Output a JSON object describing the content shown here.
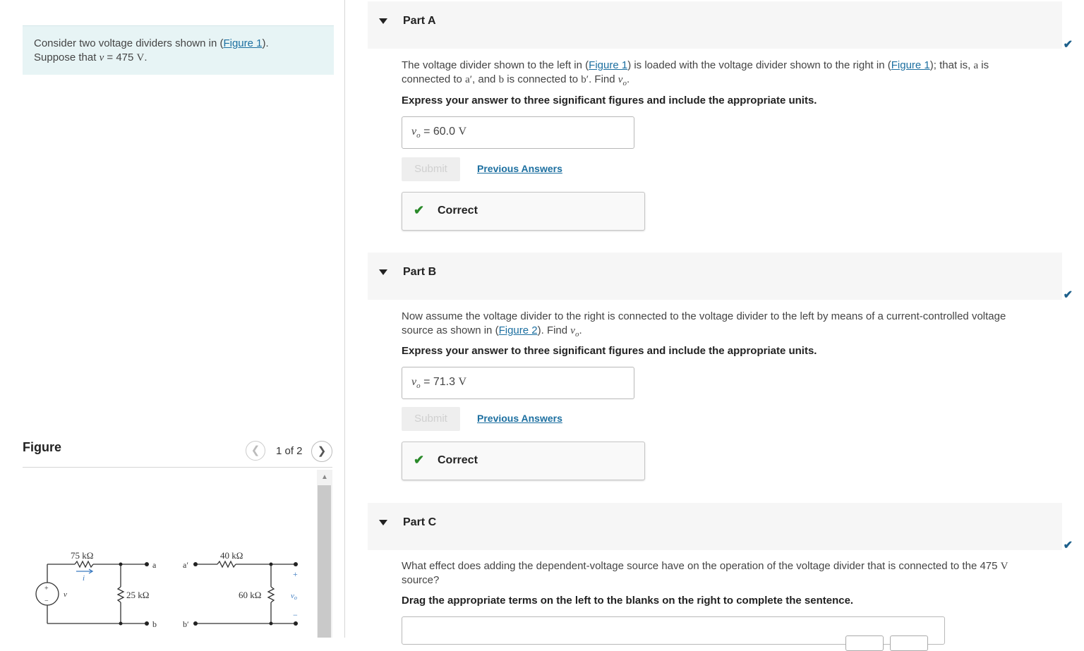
{
  "problem": {
    "line1_prefix": "Consider two voltage dividers shown in (",
    "figure_link": "Figure 1",
    "line1_suffix": ").",
    "line2_prefix": "Suppose that ",
    "v_symbol": "v",
    "line2_mid": " = 475 ",
    "unit": "V",
    "line2_suffix": "."
  },
  "figure": {
    "title": "Figure",
    "counter": "1 of 2",
    "prev_icon": "chevron-left-icon",
    "next_icon": "chevron-right-icon",
    "circuit_labels": {
      "r1": "75 kΩ",
      "r2": "25 kΩ",
      "r3": "40 kΩ",
      "r4": "60 kΩ",
      "source": "v",
      "current": "i",
      "node_a": "a",
      "node_b": "b",
      "node_a_prime": "a′",
      "node_b_prime": "b′",
      "vo": "v",
      "vo_sub": "o",
      "plus": "+",
      "minus": "−"
    }
  },
  "partA": {
    "title": "Part A",
    "q_1": "The voltage divider shown to the left in (",
    "fig": "Figure 1",
    "q_2": ") is loaded with the voltage divider shown to the right in (",
    "q_3": "); that is, ",
    "a": "a",
    "q_4": " is connected to ",
    "a_prime": "a′",
    "q_5": ", and ",
    "b": "b",
    "q_6": " is connected to ",
    "b_prime": "b′",
    "q_7": ". Find ",
    "q_8": ".",
    "instruction": "Express your answer to three significant figures and include the appropriate units.",
    "answer_prefix": "=",
    "answer_value": "60.0",
    "answer_unit": "V",
    "submit": "Submit",
    "previous": "Previous Answers",
    "feedback": "Correct"
  },
  "partB": {
    "title": "Part B",
    "q_1": "Now assume the voltage divider to the right is connected to the voltage divider to the left by means of a current-controlled voltage source as shown in (",
    "fig": "Figure 2",
    "q_2": "). Find ",
    "q_3": ".",
    "instruction": "Express your answer to three significant figures and include the appropriate units.",
    "answer_prefix": "=",
    "answer_value": "71.3",
    "answer_unit": "V",
    "submit": "Submit",
    "previous": "Previous Answers",
    "feedback": "Correct"
  },
  "partC": {
    "title": "Part C",
    "q_1": "What effect does adding the dependent-voltage source have on the operation of the voltage divider that is connected to the 475 ",
    "unit": "V",
    "q_2": " source?",
    "instruction": "Drag the appropriate terms on the left to the blanks on the right to complete the sentence."
  },
  "symbols": {
    "v": "v",
    "o": "o"
  },
  "colors": {
    "accent": "#1c6fa0",
    "check": "#1c5f8a",
    "correct_green": "#2a8a2a",
    "problem_bg": "#e7f4f5"
  }
}
